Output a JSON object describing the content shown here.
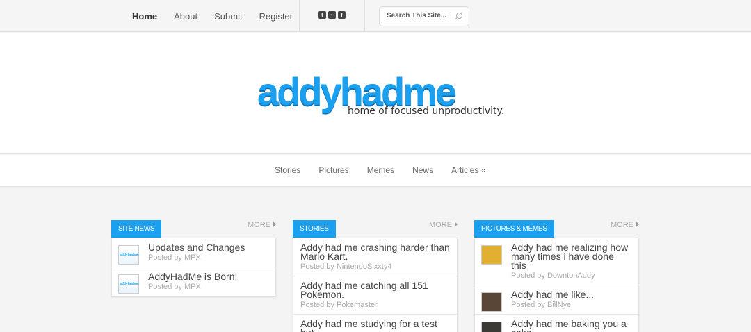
{
  "topnav": {
    "items": [
      "Home",
      "About",
      "Submit",
      "Register"
    ]
  },
  "social": {
    "icons": [
      "twitter-icon",
      "rss-icon",
      "facebook-icon"
    ]
  },
  "search": {
    "placeholder": "Search This Site..."
  },
  "header": {
    "logo": "addyhadme",
    "tagline": "home of focused unproductivity."
  },
  "catnav": {
    "items": [
      "Stories",
      "Pictures",
      "Memes",
      "News",
      "Articles »"
    ]
  },
  "columns": [
    {
      "title": "SITE NEWS",
      "more": "MORE",
      "items": [
        {
          "title": "Updates and Changes",
          "meta": "Posted by MPX"
        },
        {
          "title": "AddyHadMe is Born!",
          "meta": "Posted by MPX"
        }
      ]
    },
    {
      "title": "STORIES",
      "more": "MORE",
      "items": [
        {
          "title": "Addy had me crashing harder than Mario Kart.",
          "meta": "Posted by NintendoSixxty4"
        },
        {
          "title": "Addy had me catching all 151 Pokemon.",
          "meta": "Posted by Pokemaster"
        },
        {
          "title": "Addy had me studying for a test but",
          "meta": ""
        }
      ]
    },
    {
      "title": "PICTURES & MEMES",
      "more": "MORE",
      "items": [
        {
          "title": "Addy had me realizing how many times i have done this",
          "meta": "Posted by DowntonAddy"
        },
        {
          "title": "Addy had me like...",
          "meta": "Posted by BillNye"
        },
        {
          "title": "Addy had me baking you a cake",
          "meta": ""
        }
      ]
    }
  ],
  "colors": {
    "accent": "#1aa0ee",
    "logo_shadow": "#0c6fb2"
  }
}
